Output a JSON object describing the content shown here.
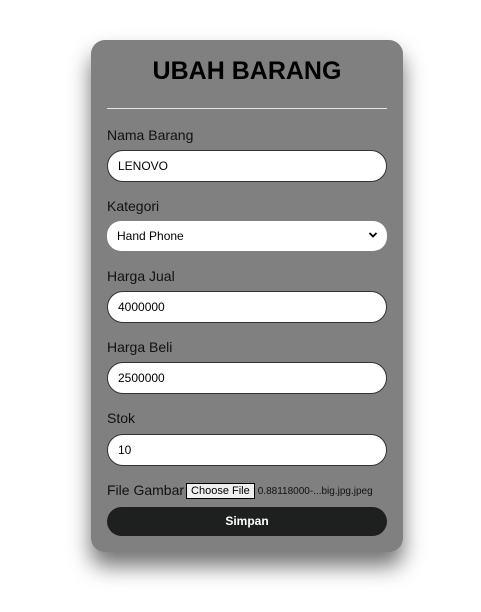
{
  "form": {
    "title": "UBAH BARANG",
    "fields": {
      "nama_barang": {
        "label": "Nama Barang",
        "value": "LENOVO"
      },
      "kategori": {
        "label": "Kategori",
        "selected": "Hand Phone"
      },
      "harga_jual": {
        "label": "Harga Jual",
        "value": "4000000"
      },
      "harga_beli": {
        "label": "Harga Beli",
        "value": "2500000"
      },
      "stok": {
        "label": "Stok",
        "value": "10"
      }
    },
    "file": {
      "label": "File Gambar",
      "button_label": "Choose File",
      "file_name": "0.88118000-...big.jpg.jpeg"
    },
    "submit_label": "Simpan"
  },
  "colors": {
    "card_background": "#808080",
    "submit_background": "#1e1f1f",
    "field_background": "#ffffff"
  },
  "icons": {
    "select_arrow": "chevron-down-icon"
  }
}
